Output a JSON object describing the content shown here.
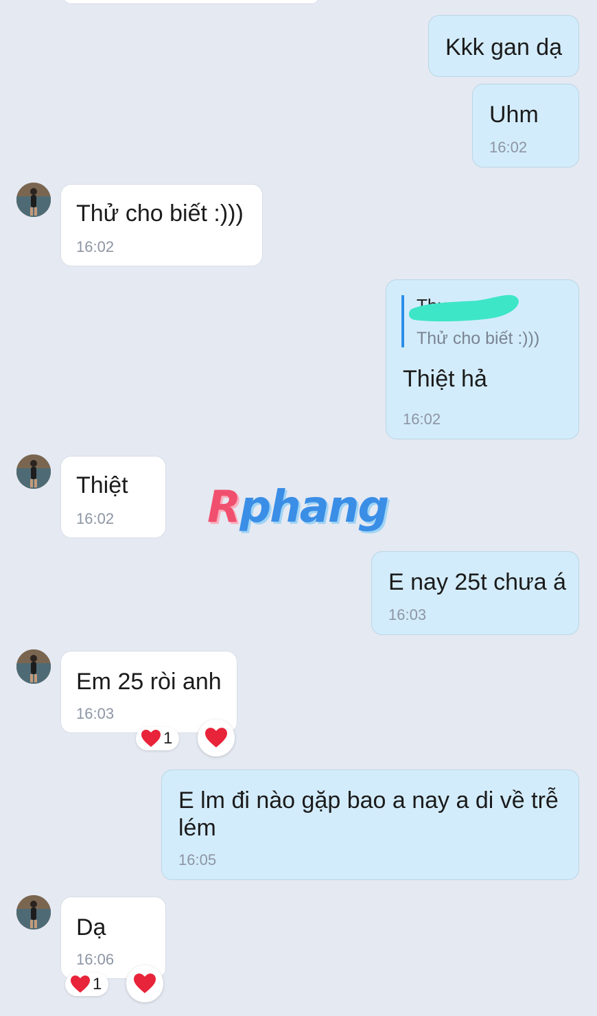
{
  "messages": [
    {
      "text": "Kkk gan dạ"
    },
    {
      "text": "Uhm",
      "time": "16:02"
    },
    {
      "text": "Thử cho biết :)))",
      "time": "16:02"
    },
    {
      "text": "Thiệt hả",
      "time": "16:02",
      "quote": {
        "name": "Thư",
        "text": "Thử cho biết :)))"
      }
    },
    {
      "text": "Thiệt",
      "time": "16:02"
    },
    {
      "text": "E nay 25t chưa á",
      "time": "16:03"
    },
    {
      "text": "Em 25 ròi anh",
      "time": "16:03",
      "reaction_count": "1"
    },
    {
      "text": "E lm đi nào gặp bao a nay a di về trễ lém",
      "time": "16:05"
    },
    {
      "text": "Dạ",
      "time": "16:06",
      "reaction_count": "1"
    }
  ],
  "watermark": {
    "first": "R",
    "rest": "phang"
  },
  "colors": {
    "background": "#e5e9f2",
    "outgoing_bubble": "#d3ecfb",
    "incoming_bubble": "#ffffff",
    "heart": "#e8243a",
    "quote_bar": "#2a8ee8",
    "scribble": "#3ee6c8"
  },
  "icons": {
    "reaction": "heart-icon",
    "avatar": "contact-avatar"
  }
}
